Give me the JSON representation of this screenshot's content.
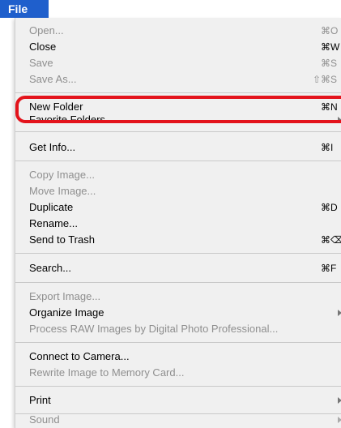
{
  "menu_title": "File",
  "items": {
    "open": {
      "label": "Open...",
      "shortcut": "⌘O"
    },
    "close": {
      "label": "Close",
      "shortcut": "⌘W"
    },
    "save": {
      "label": "Save",
      "shortcut": "⌘S"
    },
    "save_as": {
      "label": "Save As...",
      "shortcut": "⇧⌘S"
    },
    "new_folder": {
      "label": "New Folder",
      "shortcut": "⌘N"
    },
    "favorite_folders": {
      "label": "Favorite Folders"
    },
    "get_info": {
      "label": "Get Info...",
      "shortcut": "⌘I"
    },
    "copy_image": {
      "label": "Copy Image..."
    },
    "move_image": {
      "label": "Move Image..."
    },
    "duplicate": {
      "label": "Duplicate",
      "shortcut": "⌘D"
    },
    "rename": {
      "label": "Rename..."
    },
    "send_to_trash": {
      "label": "Send to Trash",
      "shortcut": "⌘⌫"
    },
    "search": {
      "label": "Search...",
      "shortcut": "⌘F"
    },
    "export_image": {
      "label": "Export Image..."
    },
    "organize_image": {
      "label": "Organize Image"
    },
    "process_raw": {
      "label": "Process RAW Images by Digital Photo Professional..."
    },
    "connect_camera": {
      "label": "Connect to Camera..."
    },
    "rewrite_image": {
      "label": "Rewrite Image to Memory Card..."
    },
    "print": {
      "label": "Print"
    },
    "sound": {
      "label": "Sound"
    }
  },
  "highlight_color": "#e3131b",
  "menubar_color": "#1f5fcc"
}
